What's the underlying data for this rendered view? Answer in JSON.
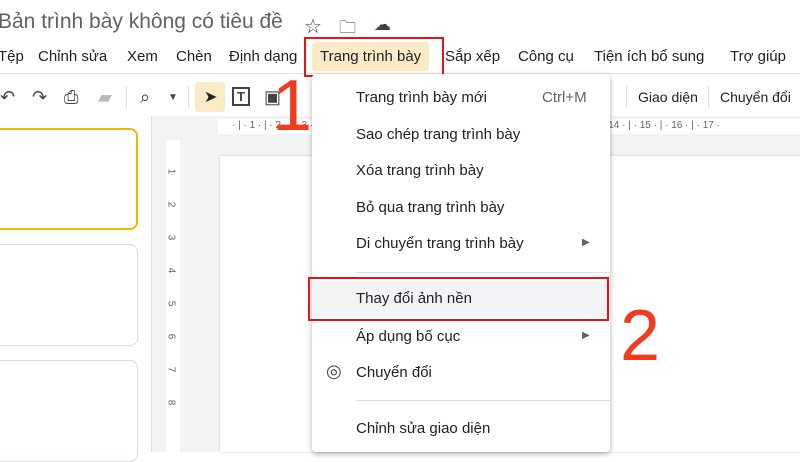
{
  "title": "Bản trình bày không có tiêu đề",
  "menubar": [
    "Tệp",
    "Chỉnh sửa",
    "Xem",
    "Chèn",
    "Định dạng",
    "Trang trình bày",
    "Sắp xếp",
    "Công cụ",
    "Tiện ích bổ sung",
    "Trợ giúp"
  ],
  "toolbar": {
    "theme": "Giao diện",
    "transition": "Chuyển đổi"
  },
  "ruler_h": "· | · 1 · | · 2 · | · 3 · | · 4 · | · 5 · | · 6 · | · 7 · | · 8 · | · 9 · | · 10 · | · 11 · | · 12 · | · 13 · | · 14 · | · 15 · | · 16 · | · 17 ·",
  "ruler_v": [
    "1",
    "2",
    "3",
    "4",
    "5",
    "6",
    "7",
    "8"
  ],
  "menu": {
    "new_slide": "Trang trình bày mới",
    "new_slide_shortcut": "Ctrl+M",
    "duplicate": "Sao chép trang trình bày",
    "delete": "Xóa trang trình bày",
    "skip": "Bỏ qua trang trình bày",
    "move": "Di chuyển trang trình bày",
    "change_background": "Thay đổi ảnh nền",
    "apply_layout": "Áp dụng bố cục",
    "transition": "Chuyển đổi",
    "edit_theme": "Chỉnh sửa giao diện"
  },
  "annotations": {
    "step1": "1",
    "step2": "2"
  }
}
